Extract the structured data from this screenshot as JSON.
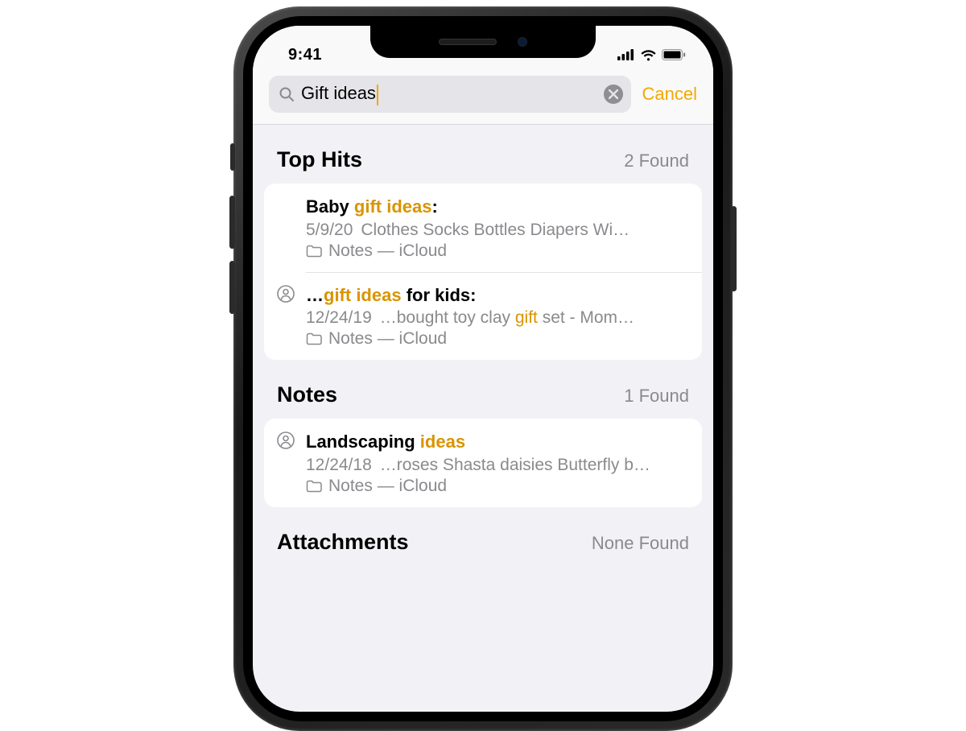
{
  "status": {
    "time": "9:41"
  },
  "accent": "#f2a900",
  "search": {
    "query": "Gift ideas",
    "cancel_label": "Cancel"
  },
  "sections": {
    "top_hits": {
      "title": "Top Hits",
      "count": "2 Found"
    },
    "notes": {
      "title": "Notes",
      "count": "1 Found"
    },
    "attachments": {
      "title": "Attachments",
      "count": "None Found"
    }
  },
  "results": {
    "top_hits": [
      {
        "title_pre": "Baby ",
        "title_hl": "gift ideas",
        "title_post": ":",
        "date": "5/9/20",
        "snippet_pre": "Clothes Socks Bottles Diapers Wi…",
        "snippet_hl": "",
        "snippet_post": "",
        "location": "Notes — iCloud",
        "shared": false
      },
      {
        "title_pre": "…",
        "title_hl": "gift ideas",
        "title_post": " for kids:",
        "date": "12/24/19",
        "snippet_pre": "…bought toy clay ",
        "snippet_hl": "gift",
        "snippet_post": " set - Mom…",
        "location": "Notes — iCloud",
        "shared": true
      }
    ],
    "notes": [
      {
        "title_pre": "Landscaping ",
        "title_hl": "ideas",
        "title_post": "",
        "date": "12/24/18",
        "snippet_pre": "…roses Shasta daisies Butterfly b…",
        "snippet_hl": "",
        "snippet_post": "",
        "location": "Notes — iCloud",
        "shared": true
      }
    ]
  }
}
